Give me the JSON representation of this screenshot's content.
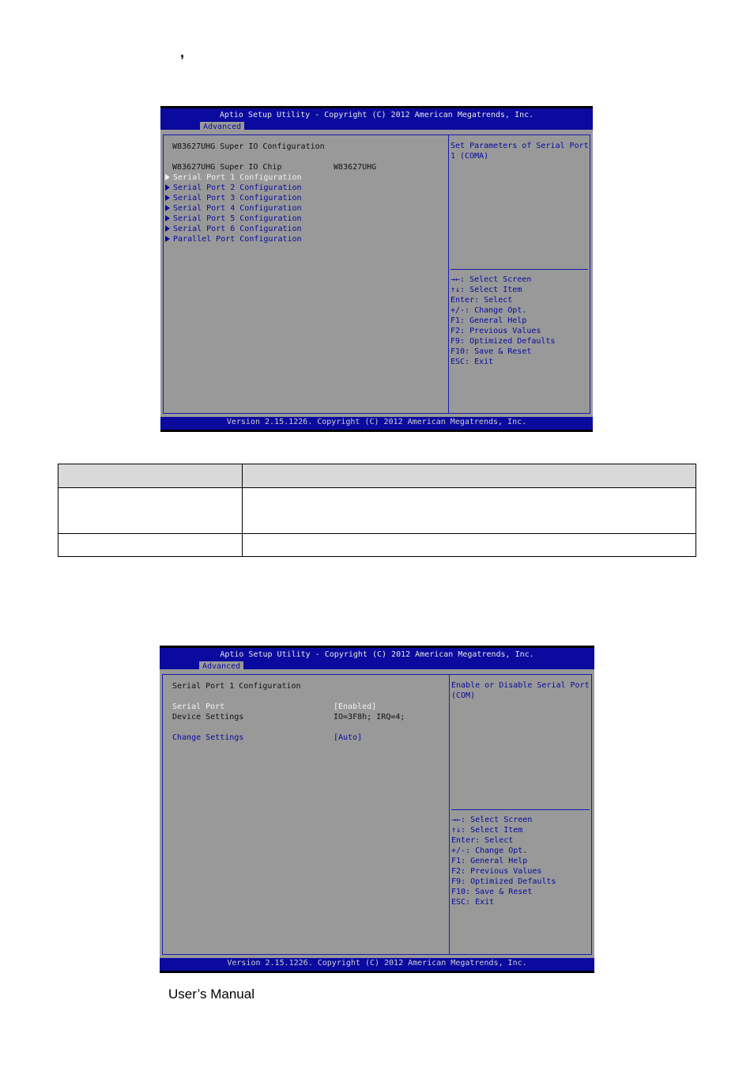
{
  "page": {
    "top_fragment": ",",
    "footer_text": "User’s Manual"
  },
  "screen1": {
    "title": "Aptio Setup Utility - Copyright (C) 2012 American Megatrends, Inc.",
    "tab": "Advanced",
    "heading": "W83627UHG Super IO Configuration",
    "chip_label": "W83627UHG Super IO Chip",
    "chip_value": "W83627UHG",
    "menu_items": [
      "Serial Port 1 Configuration",
      "Serial Port 2 Configuration",
      "Serial Port 3 Configuration",
      "Serial Port 4 Configuration",
      "Serial Port 5 Configuration",
      "Serial Port 6 Configuration",
      "Parallel Port Configuration"
    ],
    "selected_index": 0,
    "help_text_1": "Set Parameters of Serial Port",
    "help_text_2": "1 (COMA)",
    "keys": [
      "→←: Select Screen",
      "↑↓: Select Item",
      "Enter: Select",
      "+/-: Change Opt.",
      "F1: General Help",
      "F2: Previous Values",
      "F9: Optimized Defaults",
      "F10: Save & Reset",
      "ESC: Exit"
    ],
    "version": "Version 2.15.1226. Copyright (C) 2012 American Megatrends, Inc."
  },
  "table": {
    "header": [
      "",
      ""
    ],
    "rows": [
      [
        "",
        ""
      ],
      [
        "",
        ""
      ]
    ]
  },
  "screen2": {
    "title": "Aptio Setup Utility - Copyright (C) 2012 American Megatrends, Inc.",
    "tab": "Advanced",
    "heading": "Serial Port 1 Configuration",
    "serial_port_label": "Serial Port",
    "serial_port_value": "[Enabled]",
    "device_settings_label": "Device Settings",
    "device_settings_value": "IO=3F8h; IRQ=4;",
    "change_settings_label": "Change Settings",
    "change_settings_value": "[Auto]",
    "help_text_1": "Enable or Disable Serial Port",
    "help_text_2": "(COM)",
    "keys": [
      "→←: Select Screen",
      "↑↓: Select Item",
      "Enter: Select",
      "+/-: Change Opt.",
      "F1: General Help",
      "F2: Previous Values",
      "F9: Optimized Defaults",
      "F10: Save & Reset",
      "ESC: Exit"
    ],
    "version": "Version 2.15.1226. Copyright (C) 2012 American Megatrends, Inc."
  }
}
